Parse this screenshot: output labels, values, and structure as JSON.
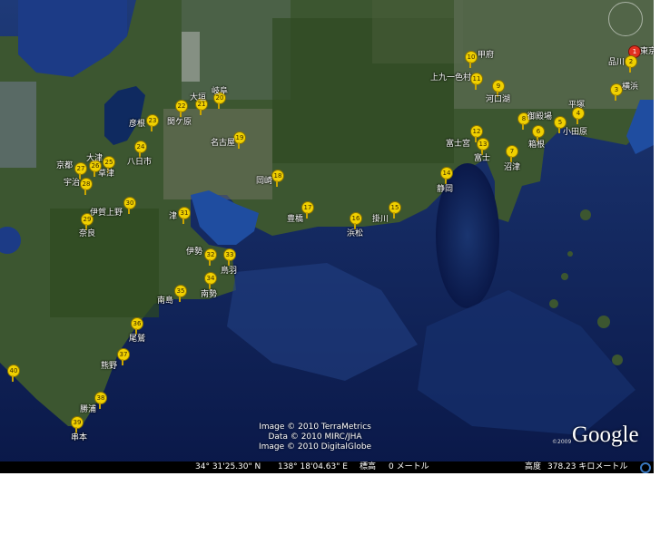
{
  "places": [
    {
      "name": "東京",
      "num": "1",
      "red": true
    },
    {
      "name": "品川",
      "num": "2"
    },
    {
      "name": "横浜",
      "num": "3"
    },
    {
      "name": "平塚",
      "num": "4"
    },
    {
      "name": "小田原",
      "num": "5"
    },
    {
      "name": "箱根",
      "num": "6"
    },
    {
      "name": "沼津",
      "num": "7"
    },
    {
      "name": "御殿場",
      "num": "8"
    },
    {
      "name": "河口湖",
      "num": "9"
    },
    {
      "name": "甲府",
      "num": "10"
    },
    {
      "name": "上九一色村",
      "num": "11"
    },
    {
      "name": "富士宮",
      "num": "12"
    },
    {
      "name": "富士",
      "num": "13"
    },
    {
      "name": "静岡",
      "num": "14"
    },
    {
      "name": "掛川",
      "num": "15"
    },
    {
      "name": "浜松",
      "num": "16"
    },
    {
      "name": "豊橋",
      "num": "17"
    },
    {
      "name": "岡崎",
      "num": "18"
    },
    {
      "name": "名古屋",
      "num": "19"
    },
    {
      "name": "岐阜",
      "num": "20"
    },
    {
      "name": "大垣",
      "num": "21"
    },
    {
      "name": "関ケ原",
      "num": "22"
    },
    {
      "name": "彦根",
      "num": "23"
    },
    {
      "name": "八日市",
      "num": "24"
    },
    {
      "name": "草津",
      "num": "25"
    },
    {
      "name": "大津",
      "num": "26"
    },
    {
      "name": "京都",
      "num": "27"
    },
    {
      "name": "宇治",
      "num": "28"
    },
    {
      "name": "奈良",
      "num": "29"
    },
    {
      "name": "伊賀上野",
      "num": "30"
    },
    {
      "name": "津",
      "num": "31"
    },
    {
      "name": "伊勢",
      "num": "32"
    },
    {
      "name": "鳥羽",
      "num": "33"
    },
    {
      "name": "南勢",
      "num": "34"
    },
    {
      "name": "南島",
      "num": "35"
    },
    {
      "name": "尾鷲",
      "num": "36"
    },
    {
      "name": "熊野",
      "num": "37"
    },
    {
      "name": "勝浦",
      "num": "38"
    },
    {
      "name": "串本",
      "num": "39"
    },
    {
      "name": "",
      "num": "40"
    }
  ],
  "credits": [
    "Image © 2010 TerraMetrics",
    "Data © 2010 MIRC/JHA",
    "Image © 2010 DigitalGlobe"
  ],
  "logo": "Google",
  "logo_year": "©2009",
  "status": {
    "lat": "34° 31'25.30\" N",
    "lon": "138° 18'04.63\" E",
    "elev_label": "標高",
    "elev_value": "0 メートル",
    "alt_label": "高度",
    "alt_value": "378.23 キロメートル"
  },
  "colors": {
    "ocean": "#0d1f55",
    "land": "#3f5a2e",
    "pin": "#f0d000",
    "pin_red": "#e23020"
  }
}
